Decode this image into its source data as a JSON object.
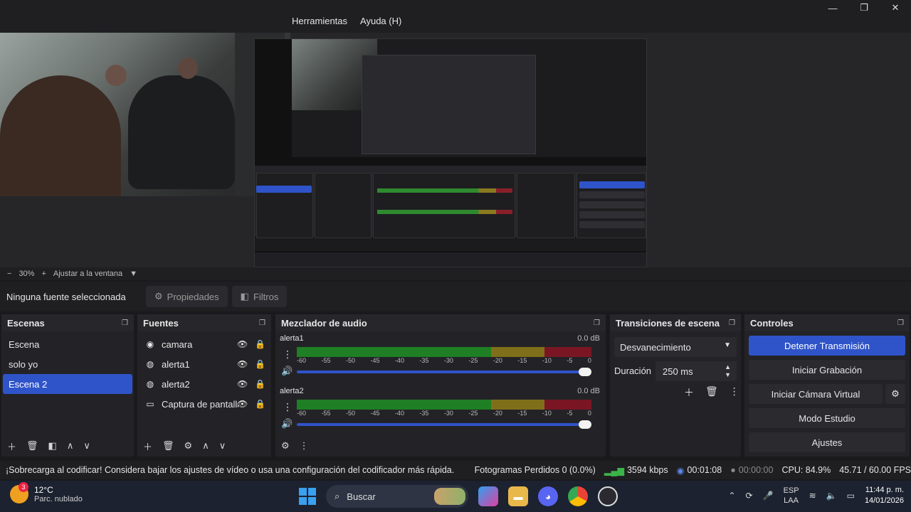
{
  "menu": {
    "items": [
      "Herramientas",
      "Ayuda (H)"
    ]
  },
  "window_controls": {
    "minimize": "—",
    "maximize": "❐",
    "close": "✕"
  },
  "zoom": {
    "minus": "−",
    "level": "30%",
    "plus": "+",
    "fit_label": "Ajustar a la ventana",
    "caret": "▼"
  },
  "source_toolbar": {
    "no_selection": "Ninguna fuente seleccionada",
    "properties": "Propiedades",
    "filters": "Filtros"
  },
  "scenes": {
    "title": "Escenas",
    "items": [
      {
        "label": "Escena",
        "selected": false
      },
      {
        "label": "solo yo",
        "selected": false
      },
      {
        "label": "Escena 2",
        "selected": true
      }
    ]
  },
  "sources": {
    "title": "Fuentes",
    "items": [
      {
        "label": "camara",
        "icon": "camera-icon"
      },
      {
        "label": "alerta1",
        "icon": "browser-icon"
      },
      {
        "label": "alerta2",
        "icon": "browser-icon"
      },
      {
        "label": "Captura de pantalla",
        "icon": "monitor-icon"
      }
    ]
  },
  "mixer": {
    "title": "Mezclador de audio",
    "scale": [
      "-60",
      "-55",
      "-50",
      "-45",
      "-40",
      "-35",
      "-30",
      "-25",
      "-20",
      "-15",
      "-10",
      "-5",
      "0"
    ],
    "tracks": [
      {
        "name": "alerta1",
        "db": "0.0 dB",
        "volume": 1.0
      },
      {
        "name": "alerta2",
        "db": "0.0 dB",
        "volume": 1.0
      }
    ]
  },
  "transitions": {
    "title": "Transiciones de escena",
    "selected": "Desvanecimiento",
    "duration_label": "Duración",
    "duration_value": "250 ms"
  },
  "controls": {
    "title": "Controles",
    "buttons": [
      "Detener Transmisión",
      "Iniciar Grabación",
      "Iniciar Cámara Virtual",
      "Modo Estudio",
      "Ajustes"
    ]
  },
  "status": {
    "warning": "¡Sobrecarga al codificar! Considera bajar los ajustes de vídeo o usa una configuración del codificador más rápida.",
    "dropped_frames": "Fotogramas Perdidos 0 (0.0%)",
    "bitrate": "3594 kbps",
    "stream_time": "00:01:08",
    "record_time": "00:00:00",
    "cpu": "CPU: 84.9%",
    "fps": "45.71 / 60.00 FPS"
  },
  "taskbar": {
    "temperature": "12°C",
    "weather": "Parc. nublado",
    "weather_badge": "3",
    "search_placeholder": "Buscar",
    "lang_top": "ESP",
    "lang_bottom": "LAA",
    "time": "11:44 p. m.",
    "date": "14/01/2026"
  },
  "colors": {
    "accent": "#2f54c9",
    "panel": "#232327",
    "background": "#1a1a1c"
  }
}
